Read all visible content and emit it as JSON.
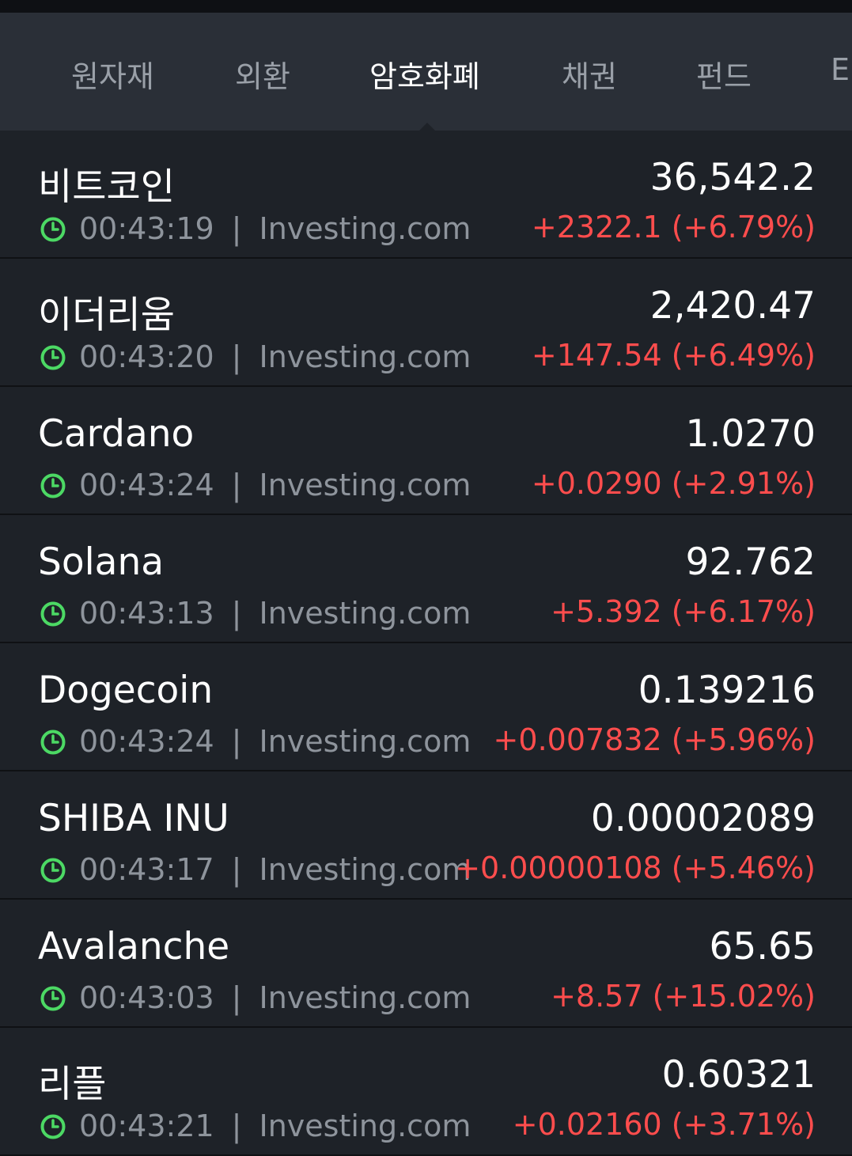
{
  "tabs": [
    {
      "label": "원자재"
    },
    {
      "label": "외환"
    },
    {
      "label": "암호화폐"
    },
    {
      "label": "채권"
    },
    {
      "label": "펀드"
    },
    {
      "label": "E"
    }
  ],
  "active_tab": "암호화폐",
  "colors": {
    "up": "#ff4d4d",
    "clock": "#4cd964",
    "background": "#1e2228",
    "tabbar": "#2a2f37"
  },
  "rows": [
    {
      "name": "비트코인",
      "time": "00:43:19",
      "source": "Investing.com",
      "price": "36,542.2",
      "change": "+2322.1 (+6.79%)"
    },
    {
      "name": "이더리움",
      "time": "00:43:20",
      "source": "Investing.com",
      "price": "2,420.47",
      "change": "+147.54 (+6.49%)"
    },
    {
      "name": "Cardano",
      "time": "00:43:24",
      "source": "Investing.com",
      "price": "1.0270",
      "change": "+0.0290 (+2.91%)"
    },
    {
      "name": "Solana",
      "time": "00:43:13",
      "source": "Investing.com",
      "price": "92.762",
      "change": "+5.392 (+6.17%)"
    },
    {
      "name": "Dogecoin",
      "time": "00:43:24",
      "source": "Investing.com",
      "price": "0.139216",
      "change": "+0.007832 (+5.96%)"
    },
    {
      "name": "SHIBA INU",
      "time": "00:43:17",
      "source": "Investing.com",
      "price": "0.00002089",
      "change": "+0.00000108 (+5.46%)"
    },
    {
      "name": "Avalanche",
      "time": "00:43:03",
      "source": "Investing.com",
      "price": "65.65",
      "change": "+8.57 (+15.02%)"
    },
    {
      "name": "리플",
      "time": "00:43:21",
      "source": "Investing.com",
      "price": "0.60321",
      "change": "+0.02160 (+3.71%)"
    }
  ],
  "separator": "|"
}
